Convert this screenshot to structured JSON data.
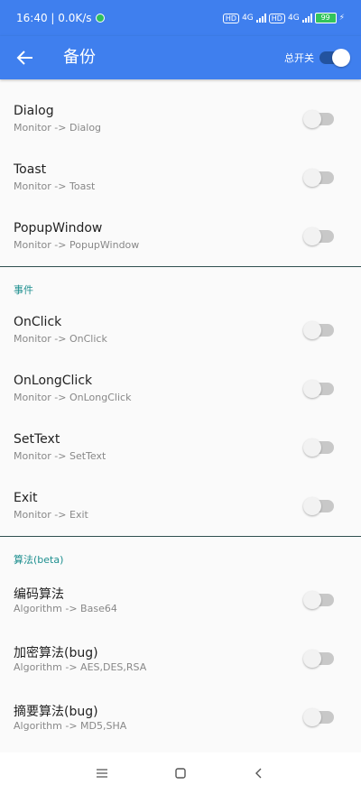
{
  "status_bar": {
    "time_speed": "16:40 | 0.0K/s",
    "hd_badge_1": "HD",
    "network_1": "4G",
    "hd_badge_2": "HD",
    "network_2": "4G",
    "battery": "99"
  },
  "app_bar": {
    "title": "备份",
    "master_switch_label": "总开关"
  },
  "sections": [
    {
      "header": "",
      "items": [
        {
          "title": "Dialog",
          "summary": "Monitor -> Dialog"
        },
        {
          "title": "Toast",
          "summary": "Monitor -> Toast"
        },
        {
          "title": "PopupWindow",
          "summary": "Monitor -> PopupWindow"
        }
      ]
    },
    {
      "header": "事件",
      "items": [
        {
          "title": "OnClick",
          "summary": "Monitor -> OnClick"
        },
        {
          "title": "OnLongClick",
          "summary": "Monitor -> OnLongClick"
        },
        {
          "title": "SetText",
          "summary": "Monitor -> SetText"
        },
        {
          "title": "Exit",
          "summary": "Monitor -> Exit"
        }
      ]
    },
    {
      "header": "算法(beta)",
      "items": [
        {
          "title": "编码算法",
          "summary": "Algorithm -> Base64"
        },
        {
          "title": "加密算法(bug)",
          "summary": "Algorithm -> AES,DES,RSA"
        },
        {
          "title": "摘要算法(bug)",
          "summary": "Algorithm -> MD5,SHA"
        }
      ]
    }
  ],
  "colors": {
    "accent": "#3f7fee",
    "category": "#1d8f8f",
    "switch_off_track": "#c8c8c8"
  },
  "icons": {
    "back": "arrow-left-icon",
    "nav_menu": "menu-icon",
    "nav_home": "square-icon",
    "nav_back": "chevron-left-icon"
  }
}
